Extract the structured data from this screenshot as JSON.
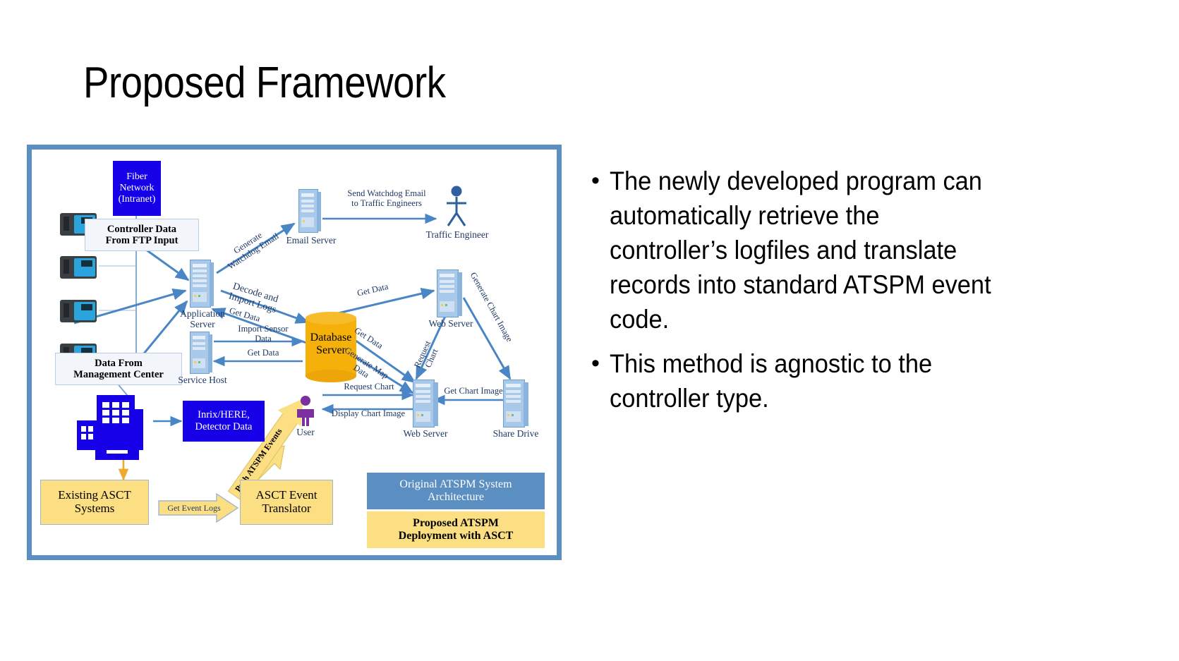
{
  "slide": {
    "title": "Proposed Framework"
  },
  "bullets": [
    {
      "marker": "•",
      "text": "The newly developed program can automatically retrieve the controller’s logfiles and translate records into standard ATSPM event code."
    },
    {
      "marker": "•",
      "text": "This method is agnostic to the controller type."
    }
  ],
  "diagram": {
    "boxes": {
      "fiber_network": "Fiber Network (Intranet)",
      "controller_data": "Controller Data From FTP Input",
      "data_from_mgmt": "Data From Management Center",
      "inrix_here": "Inrix/HERE, Detector Data",
      "existing_asct": "Existing ASCT Systems",
      "asct_translator": "ASCT Event Translator"
    },
    "box_lines": {
      "fiber_network": [
        "Fiber",
        "Network",
        "(Intranet)"
      ],
      "controller_data": [
        "Controller Data",
        "From FTP Input"
      ],
      "data_from_mgmt": [
        "Data From",
        "Management Center"
      ],
      "inrix_here": [
        "Inrix/HERE,",
        "Detector Data"
      ],
      "existing_asct": [
        "Existing ASCT",
        "Systems"
      ],
      "asct_translator": [
        "ASCT Event",
        "Translator"
      ]
    },
    "nodes": {
      "application_server": [
        "Application",
        "Server"
      ],
      "service_host": "Service Host",
      "email_server": "Email Server",
      "traffic_engineer": "Traffic Engineer",
      "database_server": [
        "Database",
        "Server"
      ],
      "web_server_top": "Web Server",
      "web_server_bottom": "Web Server",
      "share_drive": "Share Drive",
      "user": "User"
    },
    "arrow_labels": {
      "generate_watchdog": [
        "Generate",
        "Watchdog Email"
      ],
      "send_watchdog": [
        "Send Watchdog Email",
        "to Traffic Engineers"
      ],
      "decode_import": [
        "Decode and",
        "Import Logs"
      ],
      "get_data_app": "Get Data",
      "import_sensor": [
        "Import Sensor",
        "Data"
      ],
      "get_data_service": "Get Data",
      "get_data_web_top": "Get Data",
      "generate_chart_image": "Generate Chart Image",
      "request_chart_vertical": [
        "Request",
        "Chart"
      ],
      "get_data_web_bottom": "Get Data",
      "generate_map_data": [
        "Generate Map",
        "Data"
      ],
      "get_chart_image": "Get Chart Image",
      "request_chart": "Request Chart",
      "display_chart_image": "Display Chart Image",
      "push_atspm_events": "Push ATSPM Events",
      "get_event_logs": "Get Event Logs"
    },
    "legend": {
      "original_lines": [
        "Original ATSPM System",
        "Architecture"
      ],
      "proposed_lines": [
        "Proposed ATSPM",
        "Deployment with ASCT"
      ]
    },
    "colors": {
      "frame_blue": "#5b8fc2",
      "box_blue": "#1500e8",
      "database_orange": "#f5b10a",
      "yellow": "#fcdf82",
      "arrow_blue": "#4a86c5",
      "user_purple": "#7b2fa0",
      "text_navy": "#1f3864"
    }
  }
}
